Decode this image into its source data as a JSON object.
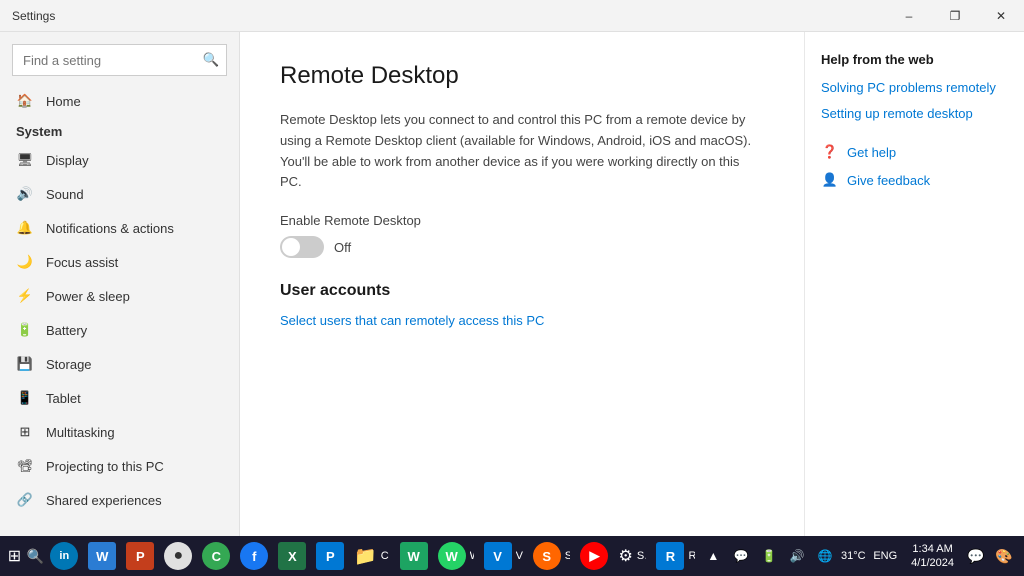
{
  "window": {
    "title": "Settings",
    "controls": {
      "minimize": "–",
      "restore": "❐",
      "close": "✕"
    }
  },
  "sidebar": {
    "search_placeholder": "Find a setting",
    "section_label": "System",
    "items": [
      {
        "id": "home",
        "label": "Home",
        "icon": "🏠"
      },
      {
        "id": "display",
        "label": "Display",
        "icon": "🖥"
      },
      {
        "id": "sound",
        "label": "Sound",
        "icon": "🔊"
      },
      {
        "id": "notifications",
        "label": "Notifications & actions",
        "icon": "🔔"
      },
      {
        "id": "focus",
        "label": "Focus assist",
        "icon": "🌙"
      },
      {
        "id": "power",
        "label": "Power & sleep",
        "icon": "⚡"
      },
      {
        "id": "battery",
        "label": "Battery",
        "icon": "🔋"
      },
      {
        "id": "storage",
        "label": "Storage",
        "icon": "💾"
      },
      {
        "id": "tablet",
        "label": "Tablet",
        "icon": "📱"
      },
      {
        "id": "multitasking",
        "label": "Multitasking",
        "icon": "⊞"
      },
      {
        "id": "projecting",
        "label": "Projecting to this PC",
        "icon": "📽"
      },
      {
        "id": "shared",
        "label": "Shared experiences",
        "icon": "🔗"
      }
    ]
  },
  "main": {
    "title": "Remote Desktop",
    "description": "Remote Desktop lets you connect to and control this PC from a remote device by using a Remote Desktop client (available for Windows, Android, iOS and macOS). You'll be able to work from another device as if you were working directly on this PC.",
    "toggle_label": "Enable Remote Desktop",
    "toggle_state": "Off",
    "user_accounts_title": "User accounts",
    "select_users_link": "Select users that can remotely access this PC"
  },
  "right_panel": {
    "help_title": "Help from the web",
    "links": [
      "Solving PC problems remotely",
      "Setting up remote desktop"
    ],
    "actions": [
      {
        "label": "Get help",
        "icon": "❓"
      },
      {
        "label": "Give feedback",
        "icon": "👤"
      }
    ]
  },
  "taskbar": {
    "start_icon": "⊞",
    "search_icon": "🔍",
    "apps": [
      {
        "label": "",
        "color": "#0078d4",
        "text": "in",
        "type": "circle"
      },
      {
        "label": "",
        "color": "#2b7cd3",
        "text": "W",
        "type": "square"
      },
      {
        "label": "",
        "color": "#c43e1c",
        "text": "P",
        "type": "square"
      },
      {
        "label": "",
        "color": "#e0e0e0",
        "text": "●",
        "text_color": "#333"
      },
      {
        "label": "",
        "color": "#34a853",
        "text": "C",
        "type": "circle"
      },
      {
        "label": "",
        "color": "#1877f2",
        "text": "f",
        "type": "circle"
      },
      {
        "label": "",
        "color": "#217346",
        "text": "X",
        "type": "square"
      },
      {
        "label": "",
        "color": "#0078d4",
        "text": "P",
        "type": "square"
      },
      {
        "label": "C:\\Users\\...",
        "color": "#ffb900",
        "text": "📁"
      },
      {
        "label": "",
        "color": "#1da462",
        "text": "W",
        "type": "square"
      },
      {
        "label": "WhatsApp",
        "color": "#25d366",
        "text": "W",
        "type": "circle"
      },
      {
        "label": "VPS Mala...",
        "color": "#0078d4",
        "text": "V",
        "type": "square"
      },
      {
        "label": "Super Bo...",
        "color": "#ff6600",
        "text": "S",
        "type": "circle"
      },
      {
        "label": "",
        "color": "#ff0000",
        "text": "▶",
        "type": "circle"
      },
      {
        "label": "Settings",
        "color": "#777",
        "text": "⚙"
      },
      {
        "label": "RDCMan ...",
        "color": "#0078d4",
        "text": "R"
      }
    ],
    "sys_icons": [
      "▲",
      "💬",
      "🔋",
      "🔊",
      "🌐"
    ],
    "temp": "31°C",
    "language": "ENG",
    "time": "1:34 AM",
    "date": "4/1/2024",
    "notification_icon": "🔔",
    "color_icon": "🎨"
  }
}
